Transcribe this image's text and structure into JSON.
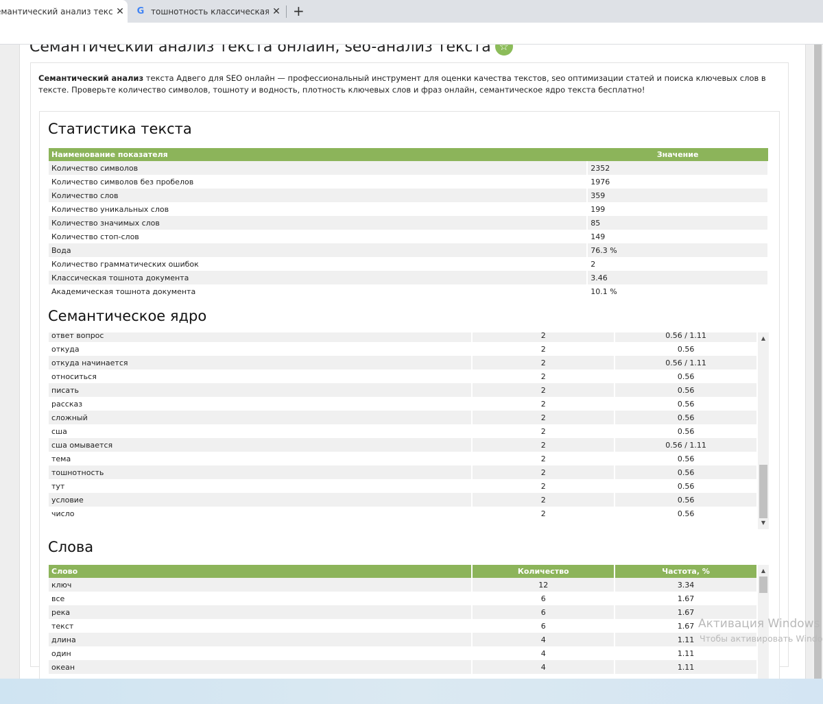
{
  "browser": {
    "tabs": [
      {
        "title": "емантический анализ текста о",
        "active": true
      },
      {
        "title": "тошнотность классическая - По",
        "active": false
      }
    ],
    "new_tab": "+",
    "close": "✕",
    "google_letter": "G"
  },
  "page": {
    "title": "Семантический анализ текста онлайн, seo-анализ текста",
    "desc_bold": "Семантический анализ",
    "desc_rest": " текста Адвего для SEO онлайн — профессиональный инструмент для оценки качества текстов, seo оптимизации статей и поиска ключевых слов в тексте. Проверьте количество символов, тошноту и водность, плотность ключевых слов и фраз онлайн, семантическое ядро текста бесплатно!"
  },
  "stats": {
    "title": "Статистика текста",
    "headers": [
      "Наименование показателя",
      "Значение"
    ],
    "rows": [
      [
        "Количество символов",
        "2352"
      ],
      [
        "Количество символов без пробелов",
        "1976"
      ],
      [
        "Количество слов",
        "359"
      ],
      [
        "Количество уникальных слов",
        "199"
      ],
      [
        "Количество значимых слов",
        "85"
      ],
      [
        "Количество стоп-слов",
        "149"
      ],
      [
        "Вода",
        "76.3 %"
      ],
      [
        "Количество грамматических ошибок",
        "2"
      ],
      [
        "Классическая тошнота документа",
        "3.46"
      ],
      [
        "Академическая тошнота документа",
        "10.1 %"
      ]
    ]
  },
  "core": {
    "title": "Семантическое ядро",
    "rows": [
      [
        "ответ вопрос",
        "2",
        "0.56 / 1.11"
      ],
      [
        "откуда",
        "2",
        "0.56"
      ],
      [
        "откуда начинается",
        "2",
        "0.56 / 1.11"
      ],
      [
        "относиться",
        "2",
        "0.56"
      ],
      [
        "писать",
        "2",
        "0.56"
      ],
      [
        "рассказ",
        "2",
        "0.56"
      ],
      [
        "сложный",
        "2",
        "0.56"
      ],
      [
        "сша",
        "2",
        "0.56"
      ],
      [
        "сша омывается",
        "2",
        "0.56 / 1.11"
      ],
      [
        "тема",
        "2",
        "0.56"
      ],
      [
        "тошнотность",
        "2",
        "0.56"
      ],
      [
        "тут",
        "2",
        "0.56"
      ],
      [
        "условие",
        "2",
        "0.56"
      ],
      [
        "число",
        "2",
        "0.56"
      ]
    ]
  },
  "words": {
    "title": "Слова",
    "headers": [
      "Слово",
      "Количество",
      "Частота, %"
    ],
    "rows": [
      [
        "ключ",
        "12",
        "3.34"
      ],
      [
        "все",
        "6",
        "1.67"
      ],
      [
        "река",
        "6",
        "1.67"
      ],
      [
        "текст",
        "6",
        "1.67"
      ],
      [
        "длина",
        "4",
        "1.11"
      ],
      [
        "один",
        "4",
        "1.11"
      ],
      [
        "океан",
        "4",
        "1.11"
      ]
    ]
  },
  "watermark": {
    "line1": "Активация Windows",
    "line2": "Чтобы активировать Windo"
  },
  "icons": {
    "star": "star-icon",
    "up_arrow": "▲",
    "down_arrow": "▼"
  }
}
